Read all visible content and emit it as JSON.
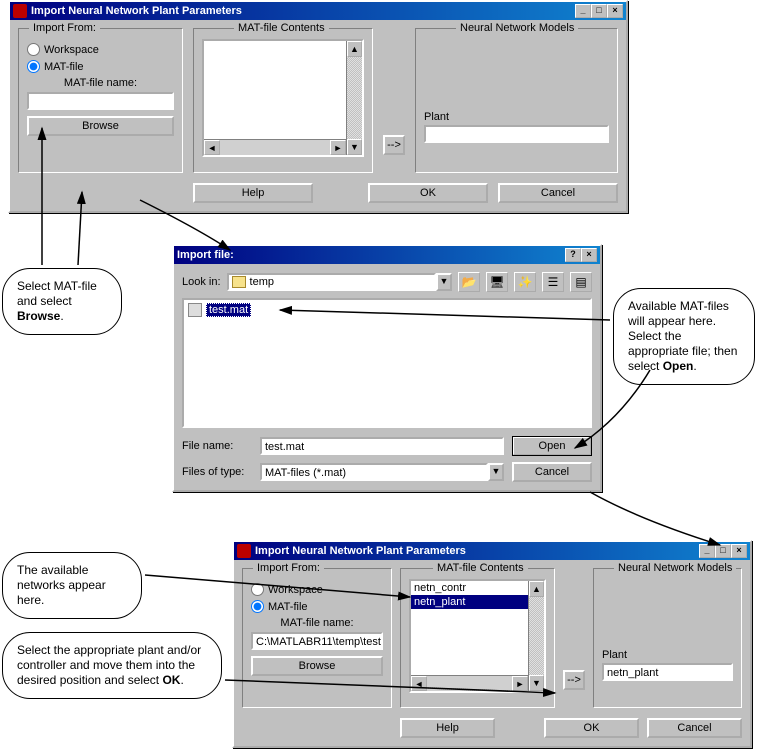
{
  "win1": {
    "title": "Import Neural Network Plant Parameters",
    "importFrom": {
      "legend": "Import From:",
      "workspace": "Workspace",
      "matfile": "MAT-file",
      "matfileName": "MAT-file name:",
      "matfileValue": "",
      "browse": "Browse"
    },
    "contentsLegend": "MAT-file Contents",
    "modelsLegend": "Neural Network Models",
    "plantLabel": "Plant",
    "plantValue": "",
    "help": "Help",
    "ok": "OK",
    "cancel": "Cancel",
    "arrow": "-->"
  },
  "win2": {
    "title": "Import file:",
    "lookIn": "Look in:",
    "folder": "temp",
    "fileItem": "test.mat",
    "fileNameLabel": "File name:",
    "fileNameValue": "test.mat",
    "filesOfTypeLabel": "Files of type:",
    "filesOfTypeValue": "MAT-files (*.mat)",
    "open": "Open",
    "cancel": "Cancel"
  },
  "win3": {
    "title": "Import Neural Network Plant Parameters",
    "importFrom": {
      "legend": "Import From:",
      "workspace": "Workspace",
      "matfile": "MAT-file",
      "matfileName": "MAT-file name:",
      "matfileValue": "C:\\MATLABR11\\temp\\test",
      "browse": "Browse"
    },
    "contentsLegend": "MAT-file Contents",
    "contents": [
      "netn_contr",
      "netn_plant"
    ],
    "selectedIndex": 1,
    "modelsLegend": "Neural Network Models",
    "plantLabel": "Plant",
    "plantValue": "netn_plant",
    "help": "Help",
    "ok": "OK",
    "cancel": "Cancel",
    "arrow": "-->"
  },
  "callouts": {
    "c1": "Select MAT-file and select <b>Browse</b>.",
    "c2": "Available MAT-files will appear here. Select the appropriate file; then select <b>Open</b>.",
    "c3": "The available networks appear here.",
    "c4": "Select the appropriate plant and/or controller and move them into the desired position and select <b>OK</b>."
  }
}
